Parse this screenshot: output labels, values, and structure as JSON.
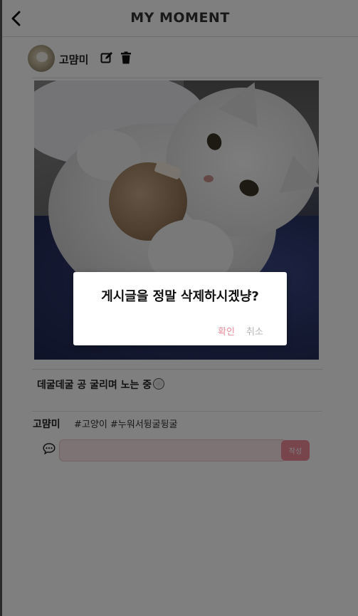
{
  "header": {
    "title": "MY MOMENT"
  },
  "post": {
    "author": "고먐미",
    "caption": "데굴데굴 공 굴리며 노는 중",
    "hashtags": "#고양이 #누워서뒹굴뒹굴"
  },
  "comment": {
    "user": "고먐미",
    "input_value": "",
    "submit_label": "작성"
  },
  "dialog": {
    "message": "게시글을 정말 삭제하시겠냥?",
    "confirm_label": "확인",
    "cancel_label": "취소"
  },
  "colors": {
    "accent_pink": "#f08a99",
    "input_pink": "#fbe5e8",
    "overlay": "rgba(0,0,0,0.5)"
  },
  "icons": {
    "back": "chevron-left-icon",
    "edit": "edit-icon",
    "delete": "trash-icon",
    "comment": "comment-icon"
  }
}
